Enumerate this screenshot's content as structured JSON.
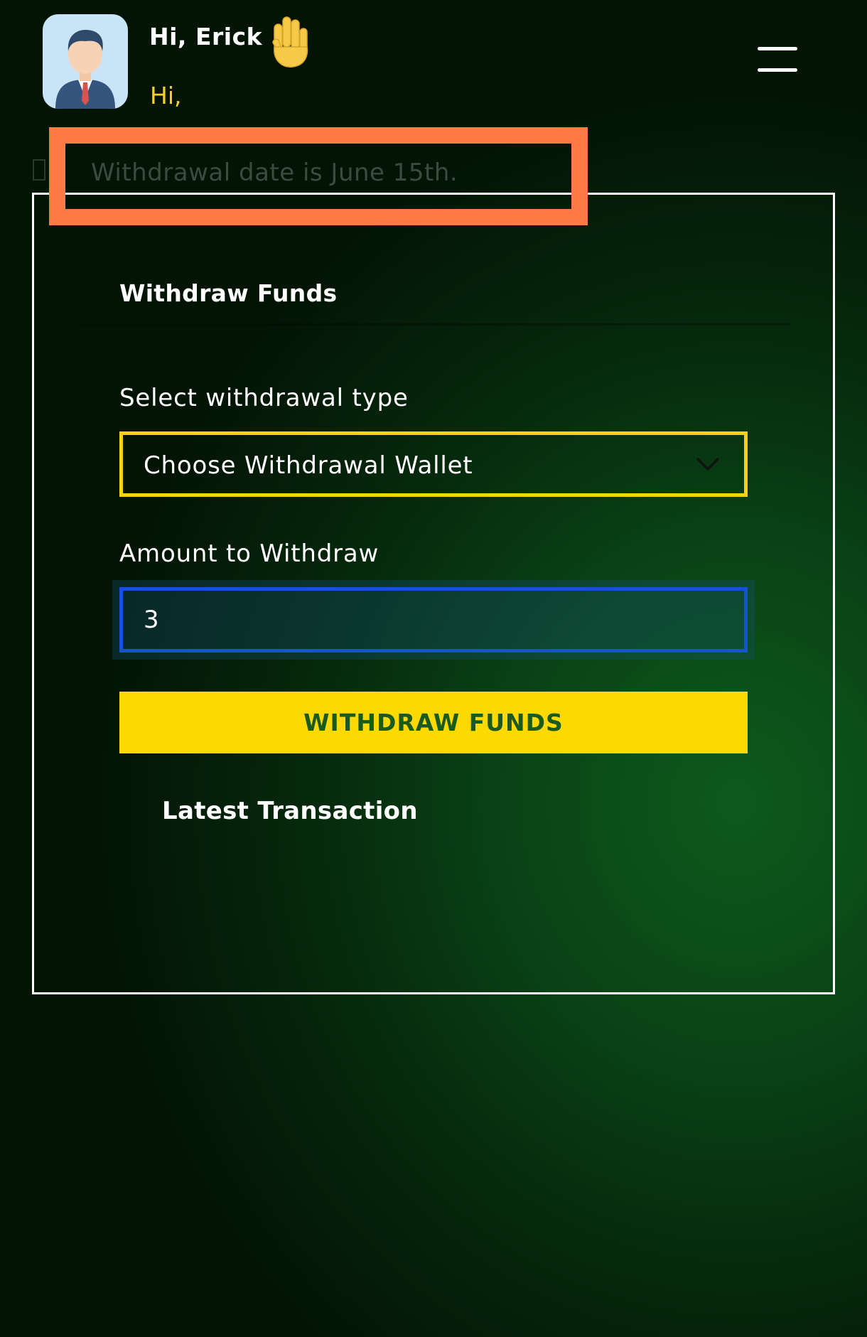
{
  "header": {
    "greeting": "Hi, Erick",
    "subgreeting": "Hi,"
  },
  "notice": {
    "text": "Withdrawal date is June 15th."
  },
  "withdraw_card": {
    "title": "Withdraw Funds",
    "type_label": "Select withdrawal type",
    "type_select_value": "Choose Withdrawal Wallet",
    "amount_label": "Amount to Withdraw",
    "amount_value": "3",
    "submit_label": "WITHDRAW FUNDS",
    "latest_title": "Latest Transaction"
  },
  "icons": {
    "avatar": "user-avatar-icon",
    "wave": "waving-hand-icon",
    "menu": "hamburger-menu-icon",
    "chevron": "chevron-down-icon"
  },
  "colors": {
    "accent_yellow": "#fcd900",
    "input_focus_blue": "#1552d6",
    "highlight_orange": "#ff7a45",
    "subgreeting_yellow": "#f5cf2a",
    "button_text_green": "#1a5a1e"
  }
}
